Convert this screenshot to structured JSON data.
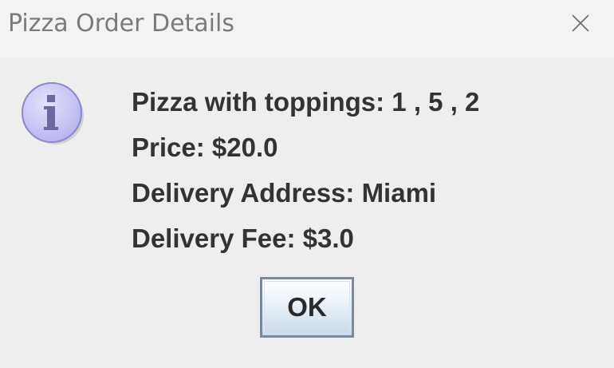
{
  "window": {
    "title": "Pizza Order Details"
  },
  "dialog": {
    "icon": "information-icon",
    "lines": [
      "Pizza with toppings: 1 , 5 , 2",
      "Price: $20.0",
      "Delivery Address: Miami",
      "Delivery Fee: $3.0"
    ],
    "ok_label": "OK"
  },
  "colors": {
    "background": "#eeeeee",
    "titlebar": "#f3f3f3",
    "title_text": "#7a7a7a",
    "message_text": "#333333",
    "button_border": "#7a8a9c",
    "icon_fill": "#c9c6f5",
    "icon_glyph": "#6b6aa0"
  }
}
